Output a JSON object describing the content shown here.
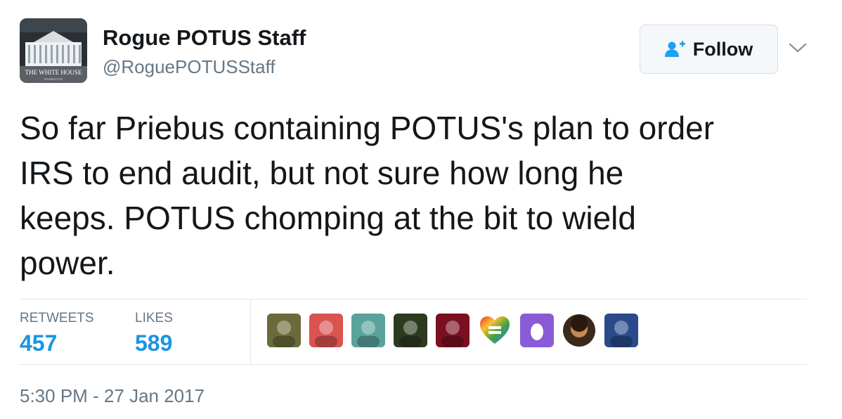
{
  "user": {
    "name": "Rogue POTUS Staff",
    "handle": "@RoguePOTUSStaff",
    "avatar_caption": "THE WHITE HOUSE",
    "avatar_subcaption": "WASHINGTON"
  },
  "follow": {
    "label": "Follow"
  },
  "tweet": {
    "lines": [
      "So far Priebus containing POTUS's plan to order",
      "IRS to end audit, but not sure how long he",
      "keeps. POTUS chomping at the bit to wield",
      "power."
    ]
  },
  "stats": {
    "retweets_label": "RETWEETS",
    "retweets_count": "457",
    "likes_label": "LIKES",
    "likes_count": "589"
  },
  "likers": [
    {
      "icon": "dog-photo-avatar",
      "color": "#6b6a3a"
    },
    {
      "icon": "woman-glasses-avatar",
      "color": "#d9534f"
    },
    {
      "icon": "robot-avatar",
      "color": "#5aa39a"
    },
    {
      "icon": "poster-avatar",
      "color": "#2e3a1f"
    },
    {
      "icon": "red-abstract-avatar",
      "color": "#7a1020"
    },
    {
      "icon": "rainbow-heart-equality-avatar",
      "color": "#e44d8a"
    },
    {
      "icon": "default-egg-avatar",
      "color": "#8a5bd6"
    },
    {
      "icon": "portrait-avatar",
      "color": "#8a5a2e"
    },
    {
      "icon": "news-anchor-avatar",
      "color": "#2a4a8a"
    }
  ],
  "timestamp": "5:30 PM - 27 Jan 2017"
}
